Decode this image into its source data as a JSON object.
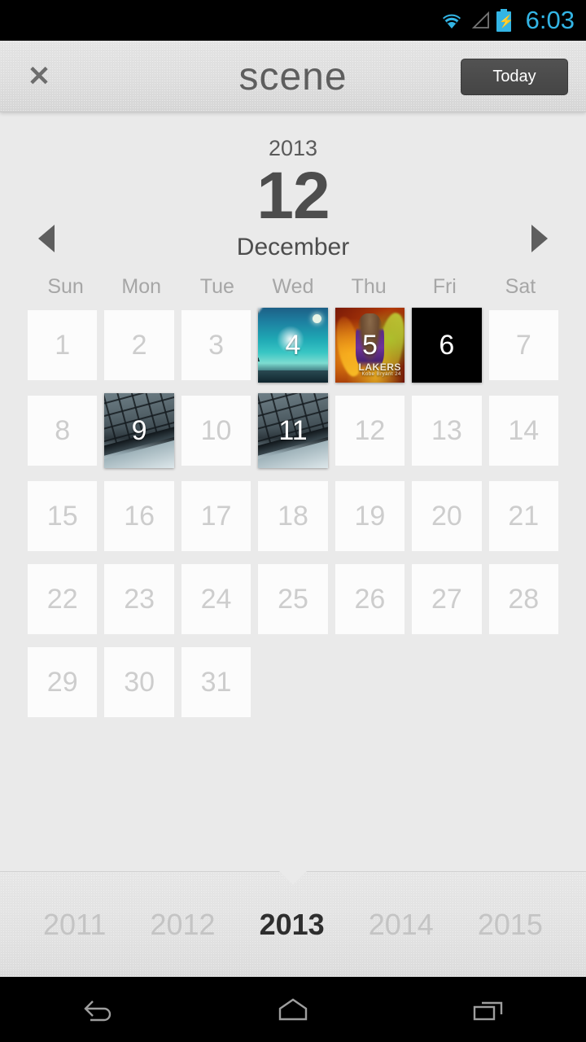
{
  "statusbar": {
    "time": "6:03",
    "icons": [
      "wifi-icon",
      "cell-signal-icon",
      "battery-charging-icon"
    ],
    "accent_color": "#33b5e5"
  },
  "header": {
    "close_label": "✕",
    "title": "scene",
    "today_label": "Today",
    "today_bg": "#4a4a4a"
  },
  "month_header": {
    "year": "2013",
    "month_number": "12",
    "month_name": "December",
    "prev_label": "prev-month",
    "next_label": "next-month"
  },
  "weekdays": [
    "Sun",
    "Mon",
    "Tue",
    "Wed",
    "Thu",
    "Fri",
    "Sat"
  ],
  "calendar": {
    "leading_blanks": 0,
    "days": [
      {
        "num": "1",
        "photo": null
      },
      {
        "num": "2",
        "photo": null
      },
      {
        "num": "3",
        "photo": null
      },
      {
        "num": "4",
        "photo": "sky"
      },
      {
        "num": "5",
        "photo": "lakers"
      },
      {
        "num": "6",
        "photo": "black"
      },
      {
        "num": "7",
        "photo": null
      },
      {
        "num": "8",
        "photo": null
      },
      {
        "num": "9",
        "photo": "keyboard"
      },
      {
        "num": "10",
        "photo": null
      },
      {
        "num": "11",
        "photo": "keyboard"
      },
      {
        "num": "12",
        "photo": null
      },
      {
        "num": "13",
        "photo": null
      },
      {
        "num": "14",
        "photo": null
      },
      {
        "num": "15",
        "photo": null
      },
      {
        "num": "16",
        "photo": null
      },
      {
        "num": "17",
        "photo": null
      },
      {
        "num": "18",
        "photo": null
      },
      {
        "num": "19",
        "photo": null
      },
      {
        "num": "20",
        "photo": null
      },
      {
        "num": "21",
        "photo": null
      },
      {
        "num": "22",
        "photo": null
      },
      {
        "num": "23",
        "photo": null
      },
      {
        "num": "24",
        "photo": null
      },
      {
        "num": "25",
        "photo": null
      },
      {
        "num": "26",
        "photo": null
      },
      {
        "num": "27",
        "photo": null
      },
      {
        "num": "28",
        "photo": null
      },
      {
        "num": "29",
        "photo": null
      },
      {
        "num": "30",
        "photo": null
      },
      {
        "num": "31",
        "photo": null
      }
    ],
    "lakers_caption": "LAKERS",
    "lakers_subcaption": "Kobe Bryant 24"
  },
  "year_strip": {
    "years": [
      "2011",
      "2012",
      "2013",
      "2014",
      "2015"
    ],
    "selected": "2013"
  },
  "navbar": {
    "back_label": "back-icon",
    "home_label": "home-icon",
    "recents_label": "recents-icon"
  }
}
